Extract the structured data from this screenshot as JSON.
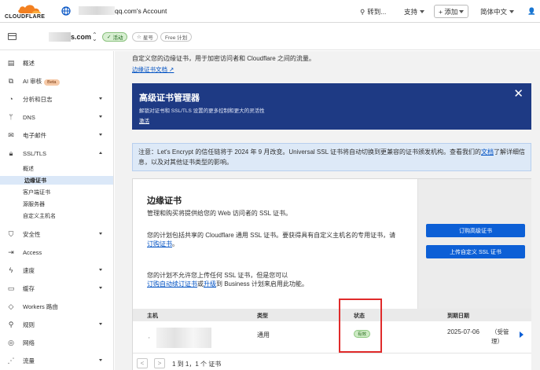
{
  "topbar": {
    "logo_text": "CLOUDFLARE",
    "account_suffix": "qq.com's Account",
    "goto_label": "转到...",
    "support_label": "支持",
    "add_label": "+ 添加",
    "language_label": "简体中文",
    "user_label": "👤"
  },
  "zonebar": {
    "zone_suffix": "s.com",
    "status_label": "活动",
    "star_label": "星号",
    "plan_label": "Free 计划"
  },
  "sidebar": {
    "items": [
      {
        "label": "概述",
        "icon": "document-icon"
      },
      {
        "label": "AI 审核",
        "icon": "ai-audit-icon",
        "badge": "Beta"
      },
      {
        "label": "分析和日志",
        "icon": "analytics-icon"
      },
      {
        "label": "DNS",
        "icon": "dns-icon"
      },
      {
        "label": "电子邮件",
        "icon": "email-icon"
      },
      {
        "label": "SSL/TLS",
        "icon": "lock-icon"
      },
      {
        "label": "安全性",
        "icon": "shield-icon"
      },
      {
        "label": "Access",
        "icon": "access-icon"
      },
      {
        "label": "速度",
        "icon": "bolt-icon"
      },
      {
        "label": "缓存",
        "icon": "cache-icon"
      },
      {
        "label": "Workers 路由",
        "icon": "workers-icon"
      },
      {
        "label": "规则",
        "icon": "rules-icon"
      },
      {
        "label": "网络",
        "icon": "network-icon"
      },
      {
        "label": "流量",
        "icon": "traffic-icon"
      }
    ],
    "ssl_subitems": [
      "概述",
      "边缘证书",
      "客户端证书",
      "源服务器",
      "自定义主机名"
    ]
  },
  "main": {
    "intro": "自定义您的边缘证书，用于加密访问者和 Cloudflare 之间的流量。",
    "doc_link": "边缘证书文档 ↗",
    "banner": {
      "title": "高级证书管理器",
      "desc": "解锁对证书和 SSL/TLS 设置的更多控制和更大的灵活性",
      "link": "激活",
      "close": "✕"
    },
    "note": {
      "text_a": "注意：Let's Encrypt 的信任链将于 2024 年 9 月改变。Universal SSL 证书将自动切换到更兼容的证书颁发机构。查看我们的",
      "link": "文档",
      "text_b": "了解详细信息，以及对其他证书类型的影响。"
    },
    "card": {
      "title": "边缘证书",
      "subtitle": "管理和购买将提供给您的 Web 访问者的 SSL 证书。",
      "p1_text": "您的计划包括共享的 Cloudflare 通用 SSL 证书。要获得具有自定义主机名的专用证书，请",
      "p1_link": "订购证书",
      "p1_end": "。",
      "p2_text": "您的计划不允许您上传任何 SSL 证书，但是您可以",
      "p2_link1": "订购自动续订证书",
      "p2_mid": "或",
      "p2_link2": "升级",
      "p2_end": "到 Business 计划来启用此功能。",
      "btn_order": "订购高级证书",
      "btn_upload": "上传自定义 SSL 证书"
    },
    "table": {
      "headers": {
        "host": "主机",
        "type": "类型",
        "status": "状态",
        "expiry": "到期日期"
      },
      "rows": [
        {
          "host_prefix": "'",
          "type": "通用",
          "status": "有效",
          "expiry": "2025-07-06",
          "managed": "（受管理）"
        }
      ]
    },
    "pager": {
      "prev": "<",
      "next": ">",
      "text": "1 到 1，1 个 证书"
    }
  }
}
